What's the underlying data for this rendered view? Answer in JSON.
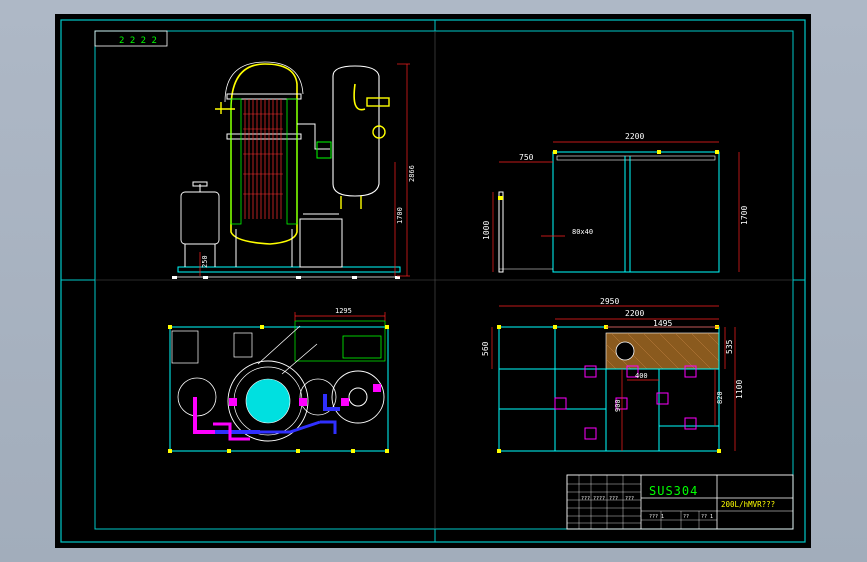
{
  "title_block": {
    "material": "SUS304",
    "drawing_name": "200L/hMVR???",
    "label_top_left": "2 2 2 2",
    "small_labels": [
      "???",
      "????",
      "???",
      "???",
      "??? 1",
      "??",
      "?? 1"
    ]
  },
  "dimensions": {
    "front_height_total": "2866",
    "front_height_lower": "1700",
    "front_offset": "250",
    "side_width": "2200",
    "side_offset": "750",
    "side_height": "1700",
    "side_low": "1000",
    "side_tube": "80x40",
    "plan_width": "1295",
    "frame_width": "2950",
    "frame_inner": "2200",
    "frame_hatch": "1495",
    "frame_left": "560",
    "frame_right_a": "535",
    "frame_right_b": "1100",
    "frame_inner_a": "400",
    "frame_inner_b": "900",
    "frame_inner_c": "820"
  },
  "colors": {
    "border": "#00c8c8",
    "frame": "#00ffff",
    "line": "#ffffff",
    "dim": "#ff2020",
    "vessel": "#ffff00",
    "pipe": "#ff00ff",
    "water": "#3030ff",
    "green": "#00ff00"
  }
}
